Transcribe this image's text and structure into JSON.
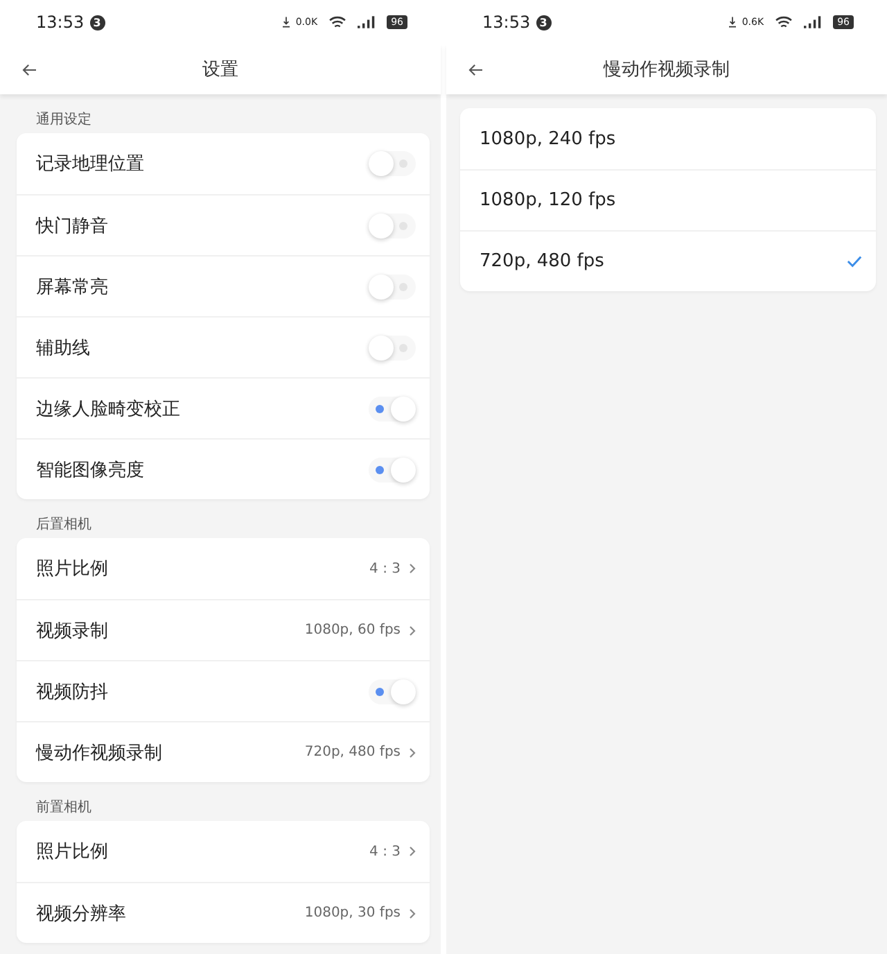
{
  "screens": [
    {
      "status": {
        "time": "13:53",
        "badge": "3",
        "speed": "0.0K",
        "battery": "96"
      },
      "title": "设置",
      "sections": [
        {
          "header": "通用设定",
          "rows": [
            {
              "kind": "toggle",
              "label": "记录地理位置",
              "on": false
            },
            {
              "kind": "toggle",
              "label": "快门静音",
              "on": false
            },
            {
              "kind": "toggle",
              "label": "屏幕常亮",
              "on": false
            },
            {
              "kind": "toggle",
              "label": "辅助线",
              "on": false
            },
            {
              "kind": "toggle",
              "label": "边缘人脸畸变校正",
              "on": true
            },
            {
              "kind": "toggle",
              "label": "智能图像亮度",
              "on": true
            }
          ]
        },
        {
          "header": "后置相机",
          "rows": [
            {
              "kind": "value",
              "label": "照片比例",
              "value": "4 : 3"
            },
            {
              "kind": "value",
              "label": "视频录制",
              "value": "1080p, 60 fps"
            },
            {
              "kind": "toggle",
              "label": "视频防抖",
              "on": true
            },
            {
              "kind": "value",
              "label": "慢动作视频录制",
              "value": "720p, 480 fps"
            }
          ]
        },
        {
          "header": "前置相机",
          "rows": [
            {
              "kind": "value",
              "label": "照片比例",
              "value": "4 : 3"
            },
            {
              "kind": "value",
              "label": "视频分辨率",
              "value": "1080p, 30 fps"
            }
          ]
        }
      ]
    },
    {
      "status": {
        "time": "13:53",
        "badge": "3",
        "speed": "0.6K",
        "battery": "96"
      },
      "title": "慢动作视频录制",
      "options": [
        {
          "label": "1080p, 240 fps",
          "selected": false
        },
        {
          "label": "1080p, 120 fps",
          "selected": false
        },
        {
          "label": "720p, 480 fps",
          "selected": true
        }
      ]
    }
  ]
}
